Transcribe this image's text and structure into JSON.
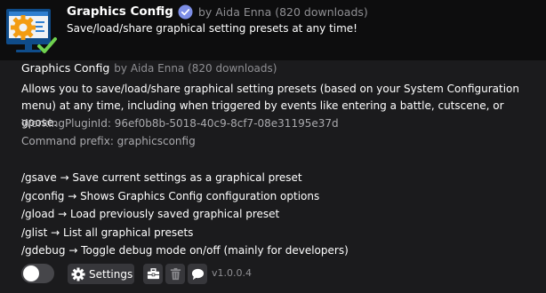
{
  "header": {
    "name": "Graphics Config",
    "author": "by Aida Enna (820 downloads)",
    "summary": "Save/load/share graphical setting presets at any time!"
  },
  "details": {
    "name": "Graphics Config",
    "author": "by Aida Enna (820 downloads)",
    "description": "Allows you to save/load/share graphical setting presets (based on your System Configuration menu) at any time, including when triggered by events like entering a battle, cutscene, or gpose.",
    "plugin_id": "WorkingPluginId: 96ef0b8b-5018-40c9-8cf7-08e31195e37d",
    "command_prefix": "Command prefix: graphicsconfig",
    "commands": [
      "/gsave → Save current settings as a graphical preset",
      "/gconfig → Shows Graphics Config configuration options",
      "/gload → Load previously saved graphical preset",
      "/glist → List all graphical presets",
      "/gdebug → Toggle debug mode on/off (mainly for developers)"
    ]
  },
  "footer": {
    "settings_label": "Settings",
    "version": "v1.0.0.4",
    "enabled": false
  },
  "icons": {
    "plugin": "gear-monitor-icon",
    "verified": "verified-check-icon",
    "settings": "gear-icon",
    "toolbox": "toolbox-icon",
    "delete": "trash-icon",
    "feedback": "chat-bubble-icon"
  },
  "colors": {
    "verified_badge": "#7d8ee6",
    "header_background": "#0d0d0e",
    "body_background": "#1b1b1d",
    "muted_text": "#8f8f93"
  }
}
